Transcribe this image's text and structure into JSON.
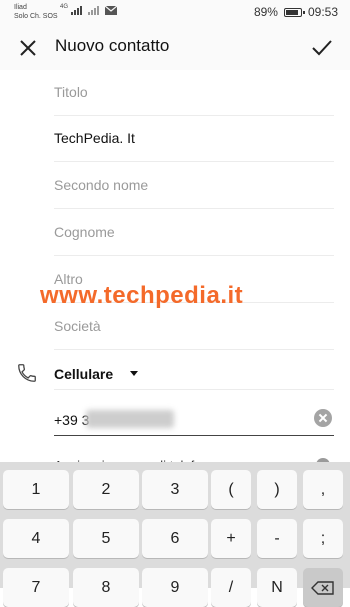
{
  "status_bar": {
    "carrier_line1": "Iliad",
    "carrier_line2": "Solo Ch. SOS",
    "network": "4G",
    "battery_pct": "89%",
    "battery_level": 0.89,
    "time": "09:53"
  },
  "app_bar": {
    "title": "Nuovo contatto"
  },
  "fields": {
    "titolo_placeholder": "Titolo",
    "nome_value": "TechPedia. It",
    "secondo_nome_placeholder": "Secondo nome",
    "cognome_placeholder": "Cognome",
    "altro_placeholder": "Altro",
    "societa_placeholder": "Società"
  },
  "phone": {
    "type_label": "Cellulare",
    "number_prefix": "+39 3",
    "add_label": "Aggiungi numero di telefono"
  },
  "watermark": "www.techpedia.it",
  "keyboard": {
    "rows": [
      [
        "1",
        "2",
        "3",
        "(",
        ")",
        ","
      ],
      [
        "4",
        "5",
        "6",
        "+",
        "-",
        ";"
      ],
      [
        "7",
        "8",
        "9",
        "/",
        "N",
        ""
      ]
    ]
  }
}
